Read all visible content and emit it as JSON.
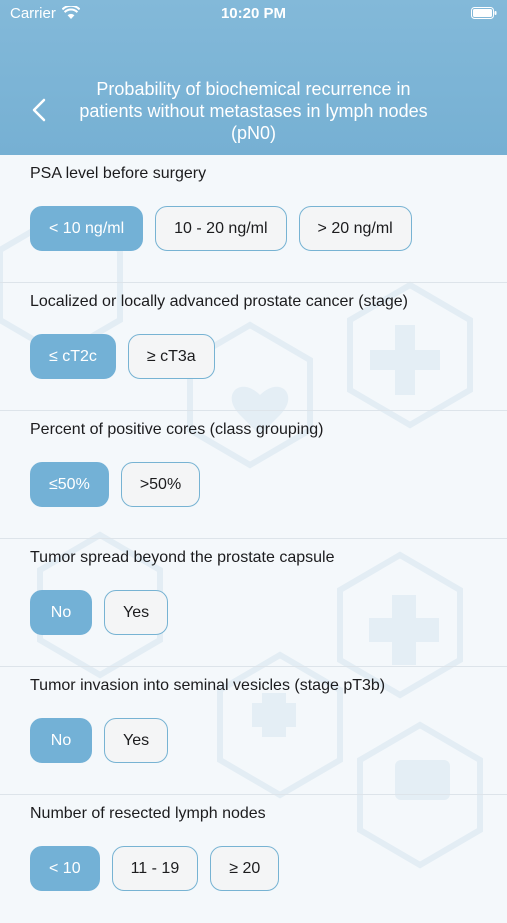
{
  "status_bar": {
    "carrier": "Carrier",
    "time": "10:20 PM"
  },
  "header": {
    "title": "Probability of biochemical recurrence in patients without metastases in lymph nodes (pN0)"
  },
  "colors": {
    "header": "#7ab4d6",
    "selected": "#73b1d6",
    "border": "#77b3d3"
  },
  "sections": [
    {
      "label": "PSA level before surgery",
      "options": [
        "< 10 ng/ml",
        "10 - 20 ng/ml",
        "> 20 ng/ml"
      ],
      "selected": 0
    },
    {
      "label": "Localized or locally advanced prostate cancer (stage)",
      "options": [
        "≤ cT2c",
        "≥ cT3a"
      ],
      "selected": 0
    },
    {
      "label": "Percent of positive cores (class grouping)",
      "options": [
        "≤50%",
        ">50%"
      ],
      "selected": 0
    },
    {
      "label": "Tumor spread beyond the prostate capsule",
      "options": [
        "No",
        "Yes"
      ],
      "selected": 0
    },
    {
      "label": "Tumor invasion into seminal vesicles (stage pT3b)",
      "options": [
        "No",
        "Yes"
      ],
      "selected": 0
    },
    {
      "label": "Number of resected lymph nodes",
      "options": [
        "< 10",
        "11 - 19",
        "≥ 20"
      ],
      "selected": 0
    }
  ]
}
